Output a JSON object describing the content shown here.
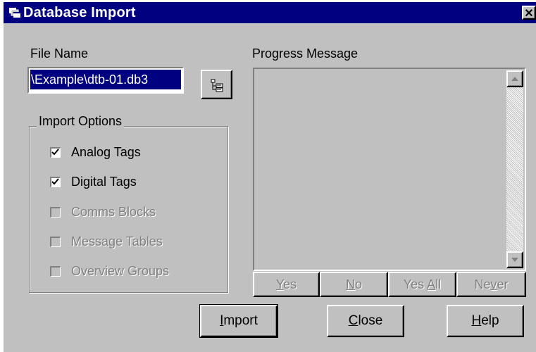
{
  "window": {
    "title": "Database Import",
    "close_glyph": "✕"
  },
  "file": {
    "label": "File Name",
    "value": "\\Example\\dtb-01.db3",
    "browse_icon": "folder-tree-icon"
  },
  "import_options": {
    "title": "Import Options",
    "items": [
      {
        "label": "Analog Tags",
        "checked": true,
        "enabled": true
      },
      {
        "label": "Digital Tags",
        "checked": true,
        "enabled": true
      },
      {
        "label": "Comms Blocks",
        "checked": false,
        "enabled": false
      },
      {
        "label": "Message Tables",
        "checked": false,
        "enabled": false
      },
      {
        "label": "Overview Groups",
        "checked": false,
        "enabled": false
      }
    ]
  },
  "progress": {
    "label": "Progress Message",
    "buttons": [
      {
        "pre": "",
        "u": "Y",
        "post": "es"
      },
      {
        "pre": "",
        "u": "N",
        "post": "o"
      },
      {
        "pre": "Yes ",
        "u": "A",
        "post": "ll"
      },
      {
        "pre": "Ne",
        "u": "v",
        "post": "er"
      }
    ]
  },
  "actions": {
    "import": {
      "pre": "",
      "u": "I",
      "post": "mport"
    },
    "close": {
      "pre": "",
      "u": "C",
      "post": "lose"
    },
    "help": {
      "pre": "",
      "u": "H",
      "post": "elp"
    }
  }
}
